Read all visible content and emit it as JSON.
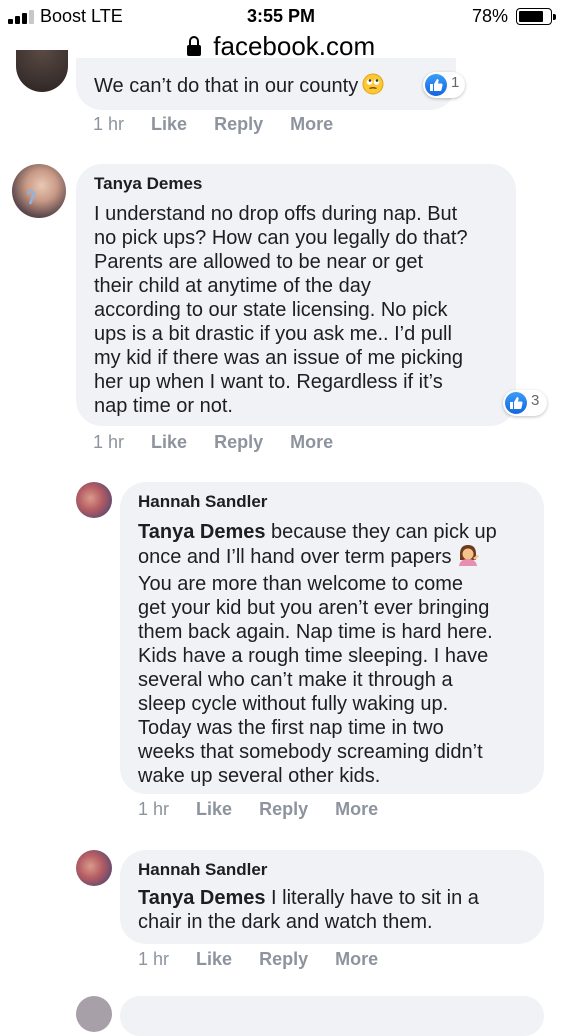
{
  "status_bar": {
    "carrier": "Boost  LTE",
    "time": "3:55 PM",
    "battery": "78%"
  },
  "browser": {
    "url": "facebook.com"
  },
  "comments": [
    {
      "text": "We can’t do that in our county",
      "reaction_count": "1",
      "meta": {
        "time": "1 hr",
        "like": "Like",
        "reply": "Reply",
        "more": "More"
      }
    },
    {
      "author": "Tanya Demes",
      "lines": [
        "I understand no drop offs during nap. But",
        "no pick ups? How can you legally do that?",
        "Parents are allowed to be near or get",
        "their child at anytime of the day",
        "according to our state licensing. No pick",
        "ups is a bit drastic if you ask me.. I’d pull",
        "my kid if there was an issue of me picking",
        "her up when I want to. Regardless if it’s",
        "nap time or not."
      ],
      "reaction_count": "3",
      "meta": {
        "time": "1 hr",
        "like": "Like",
        "reply": "Reply",
        "more": "More"
      }
    },
    {
      "author": "Hannah Sandler",
      "mention": "Tanya Demes",
      "first_line_rest": " because they can pick up",
      "lines": [
        "once and I’ll hand over term papers",
        "You are more than welcome to come",
        "get your kid but you aren’t ever bringing",
        "them back again. Nap time is hard here.",
        "Kids have a rough time sleeping. I have",
        "several who can’t make it through a",
        "sleep cycle without fully waking up.",
        "Today was the first nap time in two",
        "weeks that somebody screaming didn’t",
        "wake up several other kids."
      ],
      "meta": {
        "time": "1 hr",
        "like": "Like",
        "reply": "Reply",
        "more": "More"
      }
    },
    {
      "author": "Hannah Sandler",
      "mention": "Tanya Demes",
      "first_line_rest": " I literally have to sit in a",
      "lines": [
        "chair in the dark and watch them."
      ],
      "meta": {
        "time": "1 hr",
        "like": "Like",
        "reply": "Reply",
        "more": "More"
      }
    }
  ]
}
